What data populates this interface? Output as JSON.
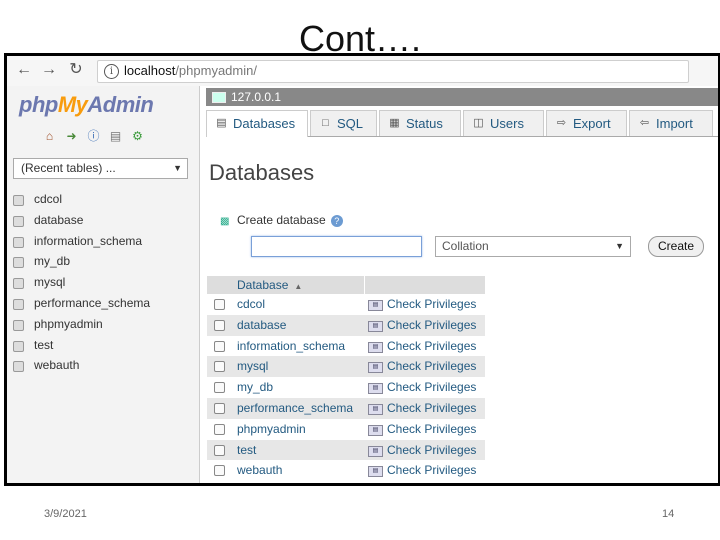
{
  "slide": {
    "title": "Cont….",
    "date": "3/9/2021",
    "page_number": "14"
  },
  "browser": {
    "back_icon": "back-arrow-icon",
    "forward_icon": "forward-arrow-icon",
    "reload_icon": "reload-icon",
    "url_host": "localhost",
    "url_path": "/phpmyadmin/"
  },
  "logo": {
    "php": "php",
    "my": "My",
    "admin": "Admin"
  },
  "left_panel": {
    "quick_icons": [
      "home-icon",
      "logout-icon",
      "help-icon",
      "docs-icon",
      "reload-icon"
    ],
    "recent_tables": "(Recent tables) ...",
    "databases": [
      "cdcol",
      "database",
      "information_schema",
      "my_db",
      "mysql",
      "performance_schema",
      "phpmyadmin",
      "test",
      "webauth"
    ]
  },
  "server": {
    "label": "127.0.0.1"
  },
  "tabs": [
    {
      "label": "Databases",
      "icon": "databases-icon",
      "active": true
    },
    {
      "label": "SQL",
      "icon": "sql-icon",
      "active": false
    },
    {
      "label": "Status",
      "icon": "status-icon",
      "active": false
    },
    {
      "label": "Users",
      "icon": "users-icon",
      "active": false
    },
    {
      "label": "Export",
      "icon": "export-icon",
      "active": false
    },
    {
      "label": "Import",
      "icon": "import-icon",
      "active": false
    }
  ],
  "main": {
    "page_title": "Databases",
    "create_label": "Create database",
    "db_name_value": "",
    "collation_placeholder": "Collation",
    "create_button": "Create",
    "table_header": "Database",
    "privileges_label": "Check Privileges",
    "rows": [
      "cdcol",
      "database",
      "information_schema",
      "mysql",
      "my_db",
      "performance_schema",
      "phpmyadmin",
      "test",
      "webauth"
    ]
  }
}
